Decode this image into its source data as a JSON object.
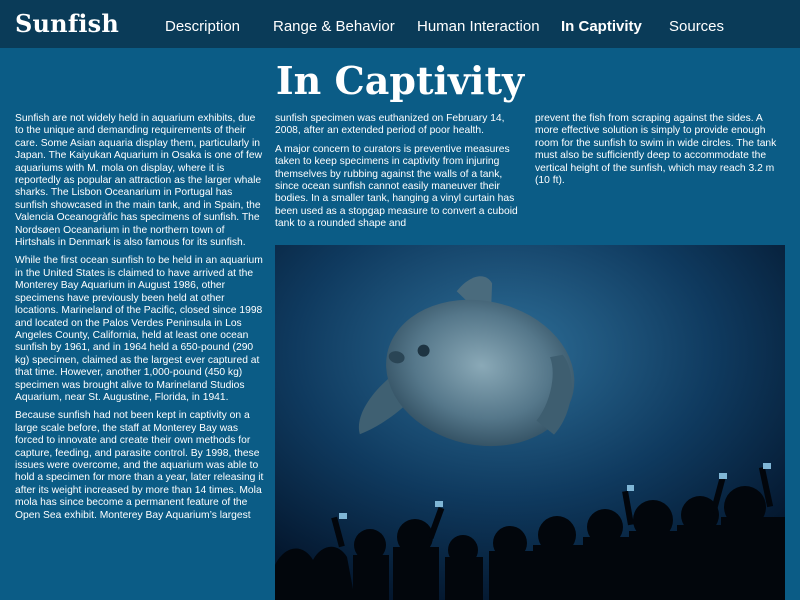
{
  "site": {
    "logo": "Sunfish"
  },
  "nav": {
    "items": [
      {
        "label": "Description",
        "active": false
      },
      {
        "label": "Range & Behavior",
        "active": false
      },
      {
        "label": "Human Interaction",
        "active": false
      },
      {
        "label": "In Captivity",
        "active": true
      },
      {
        "label": "Sources",
        "active": false
      }
    ]
  },
  "page": {
    "title": "In Captivity"
  },
  "article": {
    "col1": [
      "Sunfish are not widely held in aquarium exhibits, due to the unique and demanding requirements of their care. Some Asian aquaria display them, particularly in Japan. The Kaiyukan Aquarium in Osaka is one of few aquariums with M. mola on display, where it is reportedly as popular an attraction as the larger whale sharks. The Lisbon Oceanarium in Portugal has sunfish showcased in the main tank, and in Spain, the Valencia Oceanogràfic has specimens of sunfish. The Nordsøen Oceanarium in the northern town of Hirtshals in Denmark is also famous for its sunfish.",
      "While the first ocean sunfish to be held in an aquarium in the United States is claimed to have arrived at the Monterey Bay Aquarium in August 1986, other specimens have previously been held at other locations. Marineland of the Pacific, closed since 1998 and located on the Palos Verdes Peninsula in Los Angeles County, California, held at least one ocean sunfish by 1961, and in 1964 held a 650-pound (290 kg) specimen, claimed as the largest ever captured at that time. However, another 1,000-pound (450 kg) specimen was brought alive to Marineland Studios Aquarium, near St. Augustine, Florida, in 1941.",
      "Because sunfish had not been kept in captivity on a large scale before, the staff at Monterey Bay was forced to innovate and create their own methods for capture, feeding, and parasite control. By 1998, these issues were overcome, and the aquarium was able to hold a specimen for more than a year, later releasing it after its weight increased by more than 14 times. Mola mola has since become a permanent feature of the Open Sea exhibit. Monterey Bay Aquarium’s largest"
    ],
    "col2": [
      "sunfish specimen was euthanized on February 14, 2008, after an extended period of poor health.",
      "A major concern to curators is preventive measures taken to keep specimens in captivity from injuring themselves by rubbing against the walls of a tank, since ocean sunfish cannot easily maneuver their bodies. In a smaller tank, hanging a vinyl curtain has been used as a stopgap measure to convert a cuboid tank to a rounded shape and"
    ],
    "col3": [
      "prevent the fish from scraping against the sides. A more effective solution is simply to provide enough room for the sunfish to swim in wide circles. The tank must also be sufficiently deep to accommodate the vertical height of the sunfish, which may reach 3.2 m (10 ft)."
    ]
  },
  "photo": {
    "subject": "ocean-sunfish-aquarium-photo"
  },
  "colors": {
    "header_bg": "#0a3b58",
    "page_bg": "#0b5c86",
    "text": "#ffffff"
  }
}
